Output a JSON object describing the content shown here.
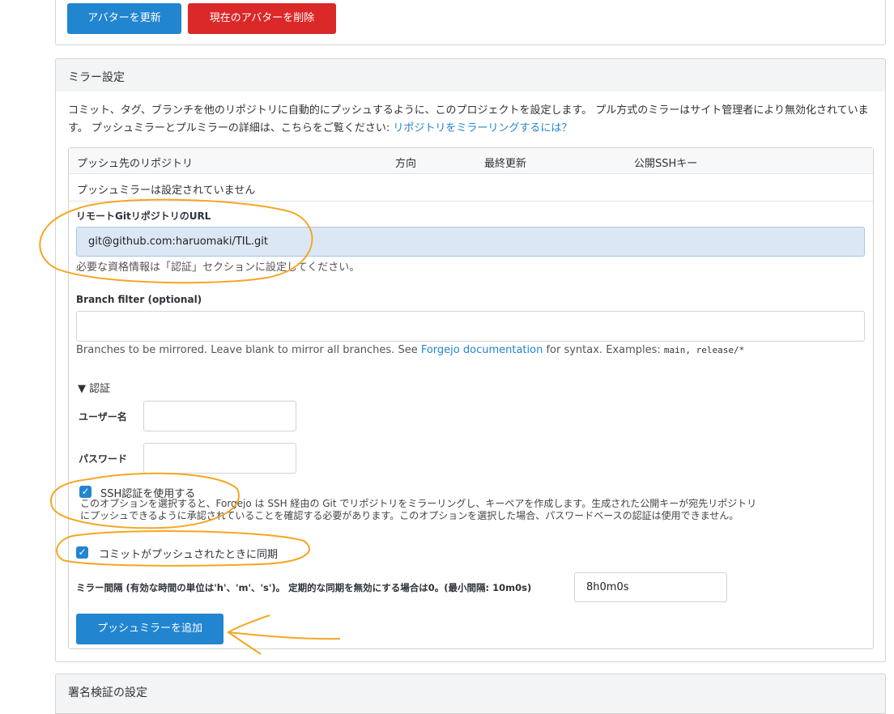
{
  "avatar": {
    "update_label": "アバターを更新",
    "delete_label": "現在のアバターを削除"
  },
  "mirror": {
    "header": "ミラー設定",
    "description_1": "コミット、タグ、ブランチを他のリポジトリに自動的にプッシュするように、このプロジェクトを設定します。 プル方式のミラーはサイト管理者により無効化されています。 プッシュミラーとプルミラーの詳細は、こちらをご覧ください: ",
    "description_link": "リポジトリをミラーリングするには？",
    "table": {
      "headers": [
        "プッシュ先のリポジトリ",
        "方向",
        "最終更新",
        "公開SSHキー"
      ],
      "empty": "プッシュミラーは設定されていません"
    },
    "form": {
      "url_label": "リモートGitリポジトリのURL",
      "url_value": "git@github.com:haruomaki/TIL.git",
      "url_help": "必要な資格情報は「認証」セクションに設定してください。",
      "branch_label": "Branch filter (optional)",
      "branch_value": "",
      "branch_help_1": "Branches to be mirrored. Leave blank to mirror all branches. See ",
      "branch_help_link": "Forgejo documentation",
      "branch_help_2": " for syntax. Examples: ",
      "branch_help_code": "main, release/*",
      "auth_toggle": "▼ 認証",
      "username_label": "ユーザー名",
      "username_value": "",
      "password_label": "パスワード",
      "password_value": "",
      "ssh_label": "SSH認証を使用する",
      "ssh_checked": true,
      "ssh_help_1": "このオプションを選択すると、Forgejo は SSH 経由の Git でリポジトリをミラーリングし、キーペアを作成します。生成された公開キーが宛先リポジトリ",
      "ssh_help_2": "にプッシュできるように承認されていることを確認する必要があります。このオプションを選択した場合、パスワードベースの認証は使用できません。",
      "sync_label": "コミットがプッシュされたときに同期",
      "sync_checked": true,
      "interval_label": "ミラー間隔 (有効な時間の単位は'h'、'm'、's')。 定期的な同期を無効にする場合は0。(最小間隔: 10m0s)",
      "interval_value": "8h0m0s",
      "submit_label": "プッシュミラーを追加"
    }
  },
  "signature": {
    "header": "署名検証の設定"
  },
  "colors": {
    "primary": "#2185d0",
    "danger": "#db2828",
    "annotation": "#f5a623",
    "url_field_bg": "#dce7f5"
  }
}
